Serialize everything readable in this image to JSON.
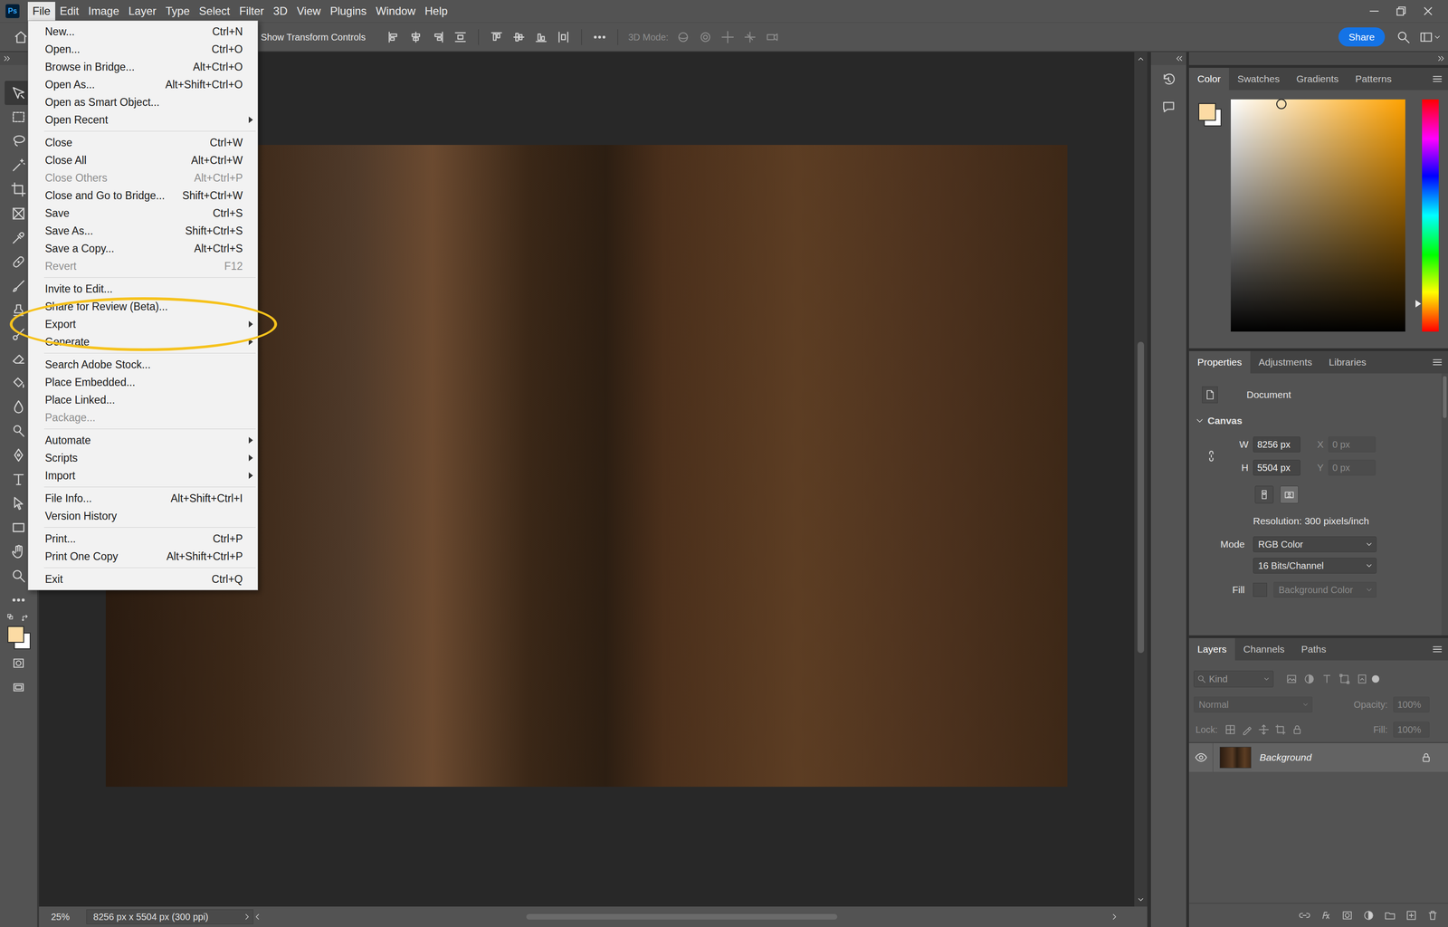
{
  "app": {
    "logo": "Ps"
  },
  "menubar": [
    {
      "label": "File",
      "selected": true
    },
    {
      "label": "Edit",
      "selected": false
    },
    {
      "label": "Image",
      "selected": false
    },
    {
      "label": "Layer",
      "selected": false
    },
    {
      "label": "Type",
      "selected": false
    },
    {
      "label": "Select",
      "selected": false
    },
    {
      "label": "Filter",
      "selected": false
    },
    {
      "label": "3D",
      "selected": false
    },
    {
      "label": "View",
      "selected": false
    },
    {
      "label": "Plugins",
      "selected": false
    },
    {
      "label": "Window",
      "selected": false
    },
    {
      "label": "Help",
      "selected": false
    }
  ],
  "options_bar": {
    "transform_label": "Show Transform Controls",
    "mode_3d_label": "3D Mode:",
    "share": "Share"
  },
  "tools": [
    {
      "selected": true
    },
    {
      "selected": false
    },
    {
      "selected": false
    },
    {
      "selected": false
    },
    {
      "selected": false
    },
    {
      "selected": false
    },
    {
      "selected": false
    },
    {
      "selected": false
    },
    {
      "selected": false
    },
    {
      "selected": false
    },
    {
      "selected": false
    },
    {
      "selected": false
    },
    {
      "selected": false
    },
    {
      "selected": false
    },
    {
      "selected": false
    },
    {
      "selected": false
    },
    {
      "selected": false
    },
    {
      "selected": false
    },
    {
      "selected": false
    },
    {
      "selected": false
    },
    {
      "selected": false
    },
    {
      "selected": false
    }
  ],
  "file_menu": [
    [
      {
        "label": "New...",
        "shortcut": "Ctrl+N",
        "disabled": false,
        "submenu": false,
        "highlighted": false
      },
      {
        "label": "Open...",
        "shortcut": "Ctrl+O",
        "disabled": false,
        "submenu": false,
        "highlighted": false
      },
      {
        "label": "Browse in Bridge...",
        "shortcut": "Alt+Ctrl+O",
        "disabled": false,
        "submenu": false,
        "highlighted": false
      },
      {
        "label": "Open As...",
        "shortcut": "Alt+Shift+Ctrl+O",
        "disabled": false,
        "submenu": false,
        "highlighted": false
      },
      {
        "label": "Open as Smart Object...",
        "disabled": false,
        "submenu": false,
        "highlighted": false
      },
      {
        "label": "Open Recent",
        "disabled": false,
        "submenu": true,
        "highlighted": false
      }
    ],
    [
      {
        "label": "Close",
        "shortcut": "Ctrl+W",
        "disabled": false,
        "submenu": false,
        "highlighted": false
      },
      {
        "label": "Close All",
        "shortcut": "Alt+Ctrl+W",
        "disabled": false,
        "submenu": false,
        "highlighted": false
      },
      {
        "label": "Close Others",
        "shortcut": "Alt+Ctrl+P",
        "disabled": true,
        "submenu": false,
        "highlighted": false
      },
      {
        "label": "Close and Go to Bridge...",
        "shortcut": "Shift+Ctrl+W",
        "disabled": false,
        "submenu": false,
        "highlighted": false
      },
      {
        "label": "Save",
        "shortcut": "Ctrl+S",
        "disabled": false,
        "submenu": false,
        "highlighted": false
      },
      {
        "label": "Save As...",
        "shortcut": "Shift+Ctrl+S",
        "disabled": false,
        "submenu": false,
        "highlighted": false
      },
      {
        "label": "Save a Copy...",
        "shortcut": "Alt+Ctrl+S",
        "disabled": false,
        "submenu": false,
        "highlighted": false
      },
      {
        "label": "Revert",
        "shortcut": "F12",
        "disabled": true,
        "submenu": false,
        "highlighted": false
      }
    ],
    [
      {
        "label": "Invite to Edit...",
        "disabled": false,
        "submenu": false,
        "highlighted": false
      },
      {
        "label": "Share for Review (Beta)...",
        "disabled": false,
        "submenu": false,
        "highlighted": false
      },
      {
        "label": "Export",
        "disabled": false,
        "submenu": true,
        "highlighted": true
      },
      {
        "label": "Generate",
        "disabled": false,
        "submenu": true,
        "highlighted": false
      }
    ],
    [
      {
        "label": "Search Adobe Stock...",
        "disabled": false,
        "submenu": false,
        "highlighted": false
      },
      {
        "label": "Place Embedded...",
        "disabled": false,
        "submenu": false,
        "highlighted": false
      },
      {
        "label": "Place Linked...",
        "disabled": false,
        "submenu": false,
        "highlighted": false
      },
      {
        "label": "Package...",
        "disabled": true,
        "submenu": false,
        "highlighted": false
      }
    ],
    [
      {
        "label": "Automate",
        "disabled": false,
        "submenu": true,
        "highlighted": false
      },
      {
        "label": "Scripts",
        "disabled": false,
        "submenu": true,
        "highlighted": false
      },
      {
        "label": "Import",
        "disabled": false,
        "submenu": true,
        "highlighted": false
      }
    ],
    [
      {
        "label": "File Info...",
        "shortcut": "Alt+Shift+Ctrl+I",
        "disabled": false,
        "submenu": false,
        "highlighted": false
      },
      {
        "label": "Version History",
        "disabled": false,
        "submenu": false,
        "highlighted": false
      }
    ],
    [
      {
        "label": "Print...",
        "shortcut": "Ctrl+P",
        "disabled": false,
        "submenu": false,
        "highlighted": false
      },
      {
        "label": "Print One Copy",
        "shortcut": "Alt+Shift+Ctrl+P",
        "disabled": false,
        "submenu": false,
        "highlighted": false
      }
    ],
    [
      {
        "label": "Exit",
        "shortcut": "Ctrl+Q",
        "disabled": false,
        "submenu": false,
        "highlighted": false
      }
    ]
  ],
  "color_panel": {
    "tabs": [
      {
        "label": "Color",
        "selected": true
      },
      {
        "label": "Swatches",
        "selected": false
      },
      {
        "label": "Gradients",
        "selected": false
      },
      {
        "label": "Patterns",
        "selected": false
      }
    ],
    "foreground": "#fcdba4",
    "background": "#ffffff",
    "field_x": 0.29,
    "field_y": 0.02,
    "hue_level": 0.88
  },
  "properties_panel": {
    "tabs": [
      {
        "label": "Properties",
        "selected": true
      },
      {
        "label": "Adjustments",
        "selected": false
      },
      {
        "label": "Libraries",
        "selected": false
      }
    ],
    "document_label": "Document",
    "section": {
      "label": "Canvas",
      "expanded": true
    },
    "linked": true,
    "width": {
      "label": "W",
      "value": "8256 px",
      "disabled": false
    },
    "height": {
      "label": "H",
      "value": "5504 px",
      "disabled": false
    },
    "x": {
      "label": "X",
      "value": "0 px",
      "disabled": true
    },
    "y": {
      "label": "Y",
      "value": "0 px",
      "disabled": true
    },
    "orientation": [
      {
        "kind": "portrait",
        "selected": false
      },
      {
        "kind": "landscape",
        "selected": true
      }
    ],
    "resolution": "Resolution: 300 pixels/inch",
    "mode": {
      "label": "Mode",
      "value": "RGB Color"
    },
    "depth": {
      "value": "16 Bits/Channel"
    },
    "fill": {
      "label": "Fill",
      "value": "Background Color",
      "disabled": true
    }
  },
  "layers_panel": {
    "tabs": [
      {
        "label": "Layers",
        "selected": true
      },
      {
        "label": "Channels",
        "selected": false
      },
      {
        "label": "Paths",
        "selected": false
      }
    ],
    "filter": {
      "value": "Kind"
    },
    "blend": {
      "value": "Normal",
      "disabled": true
    },
    "opacity": {
      "label": "Opacity:",
      "value": "100%",
      "disabled": true
    },
    "lock": {
      "label": "Lock:"
    },
    "fill": {
      "label": "Fill:",
      "value": "100%",
      "disabled": true
    },
    "layers": [
      {
        "name": "Background",
        "visible": true,
        "locked": true,
        "selected": true
      }
    ]
  },
  "status_bar": {
    "zoom": "25%",
    "info": "8256 px x 5504 px (300 ppi)"
  }
}
